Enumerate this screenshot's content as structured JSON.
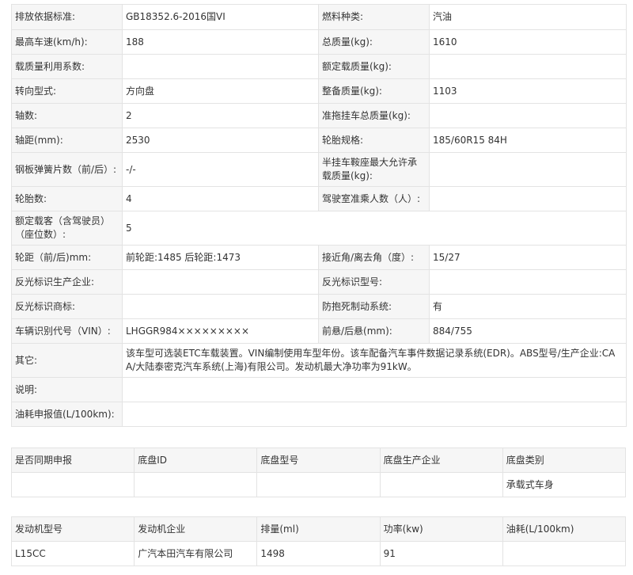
{
  "spec": {
    "emission_std": {
      "label": "排放依据标准:",
      "value": "GB18352.6-2016国VI"
    },
    "fuel_type": {
      "label": "燃料种类:",
      "value": "汽油"
    },
    "max_speed": {
      "label": "最高车速(km/h):",
      "value": "188"
    },
    "total_mass": {
      "label": "总质量(kg):",
      "value": "1610"
    },
    "load_util": {
      "label": "载质量利用系数:",
      "value": ""
    },
    "rated_load": {
      "label": "额定载质量(kg):",
      "value": ""
    },
    "steering": {
      "label": "转向型式:",
      "value": "方向盘"
    },
    "curb_mass": {
      "label": "整备质量(kg):",
      "value": "1103"
    },
    "axles": {
      "label": "轴数:",
      "value": "2"
    },
    "trailer_mass": {
      "label": "准拖挂车总质量(kg):",
      "value": ""
    },
    "wheelbase": {
      "label": "轴距(mm):",
      "value": "2530"
    },
    "tire_spec": {
      "label": "轮胎规格:",
      "value": "185/60R15 84H"
    },
    "leaf_springs": {
      "label": "钢板弹簧片数（前/后）:",
      "value": "-/-"
    },
    "saddle_load": {
      "label": "半挂车鞍座最大允许承载质量(kg):",
      "value": ""
    },
    "tires": {
      "label": "轮胎数:",
      "value": "4"
    },
    "cab_seats": {
      "label": "驾驶室准乘人数（人）:",
      "value": ""
    },
    "passengers": {
      "label": "额定载客（含驾驶员）（座位数）:",
      "value": "5"
    },
    "track": {
      "label": "轮距（前/后)mm:",
      "value": "前轮距:1485 后轮距:1473"
    },
    "angles": {
      "label": "接近角/离去角（度）:",
      "value": "15/27"
    },
    "reflector_maker": {
      "label": "反光标识生产企业:",
      "value": ""
    },
    "reflector_model": {
      "label": "反光标识型号:",
      "value": ""
    },
    "reflector_brand": {
      "label": "反光标识商标:",
      "value": ""
    },
    "abs": {
      "label": "防抱死制动系统:",
      "value": "有"
    },
    "vin": {
      "label": "车辆识别代号（VIN）:",
      "value": "LHGGR984×××××××××"
    },
    "overhang": {
      "label": "前悬/后悬(mm):",
      "value": "884/755"
    },
    "other": {
      "label": "其它:",
      "value": "该车型可选装ETC车载装置。VIN编制使用车型年份。该车配备汽车事件数据记录系统(EDR)。ABS型号/生产企业:CAA/大陆泰密克汽车系统(上海)有限公司。发动机最大净功率为91kW。"
    },
    "notes": {
      "label": "说明:",
      "value": ""
    },
    "fuel_report": {
      "label": "油耗申报值(L/100km):",
      "value": ""
    }
  },
  "chassis": {
    "headers": [
      "是否同期申报",
      "底盘ID",
      "底盘型号",
      "底盘生产企业",
      "底盘类别"
    ],
    "row": [
      "",
      "",
      "",
      "",
      "承载式车身"
    ]
  },
  "engine": {
    "headers": [
      "发动机型号",
      "发动机企业",
      "排量(ml)",
      "功率(kw)",
      "油耗(L/100km)"
    ],
    "row": [
      "L15CC",
      "广汽本田汽车有限公司",
      "1498",
      "91",
      ""
    ]
  }
}
